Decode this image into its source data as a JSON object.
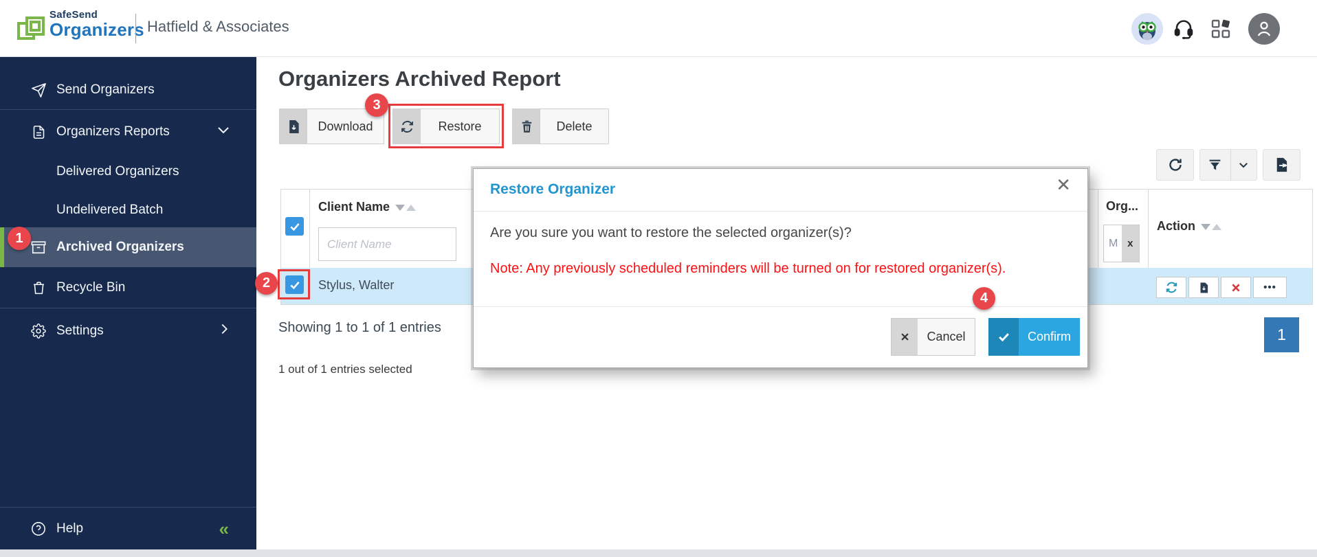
{
  "header": {
    "brand_top": "SafeSend",
    "brand_bottom": "Organizers",
    "company": "Hatfield & Associates"
  },
  "sidebar": {
    "send": "Send Organizers",
    "reports": "Organizers Reports",
    "delivered": "Delivered Organizers",
    "undelivered": "Undelivered Batch",
    "archived": "Archived Organizers",
    "recycle": "Recycle Bin",
    "settings": "Settings",
    "help": "Help",
    "collapse_glyph": "«"
  },
  "annotations": {
    "n1": "1",
    "n2": "2",
    "n3": "3",
    "n4": "4"
  },
  "toolbar": {
    "download": "Download",
    "restore": "Restore",
    "delete": "Delete"
  },
  "table": {
    "client_name_header": "Client Name",
    "client_name_placeholder": "Client Name",
    "org_header": "Org...",
    "org_filter_value": "M",
    "org_clear_glyph": "x",
    "action_header": "Action",
    "row_client_name": "Stylus, Walter",
    "ellipsis_glyph": "•••"
  },
  "summary": {
    "showing": "Showing 1 to 1 of 1 entries",
    "selected": "1 out of 1 entries selected",
    "page": "1"
  },
  "modal": {
    "title": "Restore Organizer",
    "message": "Are you sure you want to restore the selected organizer(s)?",
    "note": "Note: Any previously scheduled reminders will be turned on for restored organizer(s).",
    "close_glyph": "✕",
    "cancel": "Cancel",
    "confirm": "Confirm"
  },
  "colors": {
    "sidebar_navy": "#17294d",
    "active_item_bg": "#475671",
    "accent_green": "#7ab648",
    "brand_blue": "#2175bc",
    "annotation_red": "#e8464b",
    "checkbox_blue": "#3897e2",
    "selected_row_blue": "#cde9fa",
    "modal_title_blue": "#2095ce",
    "note_red": "#fd1014",
    "confirm_blue": "#2ba6e0",
    "pagination_blue": "#3478b5"
  }
}
